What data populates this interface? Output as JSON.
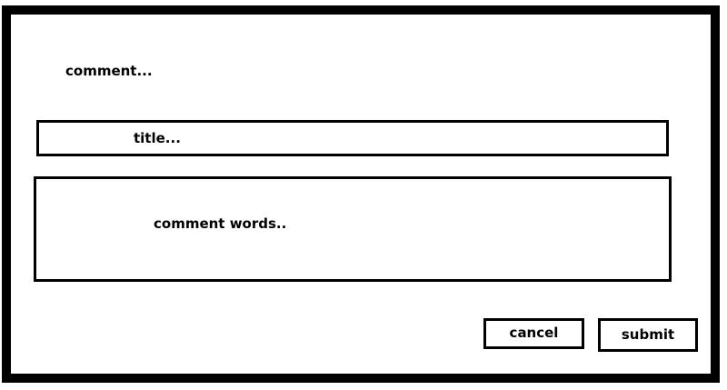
{
  "dialog": {
    "heading": "comment...",
    "title_field": {
      "placeholder": "title..."
    },
    "comment_field": {
      "placeholder": "comment words.."
    },
    "buttons": {
      "cancel_label": "cancel",
      "submit_label": "submit"
    }
  }
}
